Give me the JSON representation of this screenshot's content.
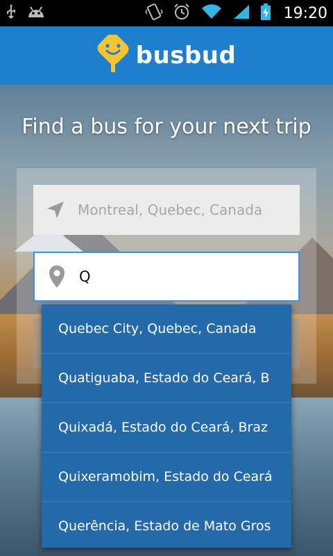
{
  "status_bar": {
    "time": "19:20",
    "icons": [
      "usb-icon",
      "android-icon",
      "vibrate-icon",
      "alarm-icon",
      "wifi-icon",
      "signal-icon",
      "battery-charging-icon"
    ]
  },
  "app_bar": {
    "brand_name": "busbud",
    "brand_color": "#1f7fcf"
  },
  "main": {
    "headline": "Find a bus for your next trip",
    "origin": {
      "value": "Montreal, Quebec, Canada",
      "icon": "navigation-arrow-icon"
    },
    "destination": {
      "value": "Q",
      "icon": "location-pin-icon"
    },
    "suggestions": [
      {
        "label": "Quebec City, Quebec, Canada"
      },
      {
        "label": "Quatiguaba, Estado do Ceará, B"
      },
      {
        "label": "Quixadá, Estado do Ceará, Braz"
      },
      {
        "label": "Quixeramobim, Estado do Ceará"
      },
      {
        "label": "Querência, Estado de Mato Gros"
      }
    ],
    "dropdown_color": "#246aab"
  }
}
